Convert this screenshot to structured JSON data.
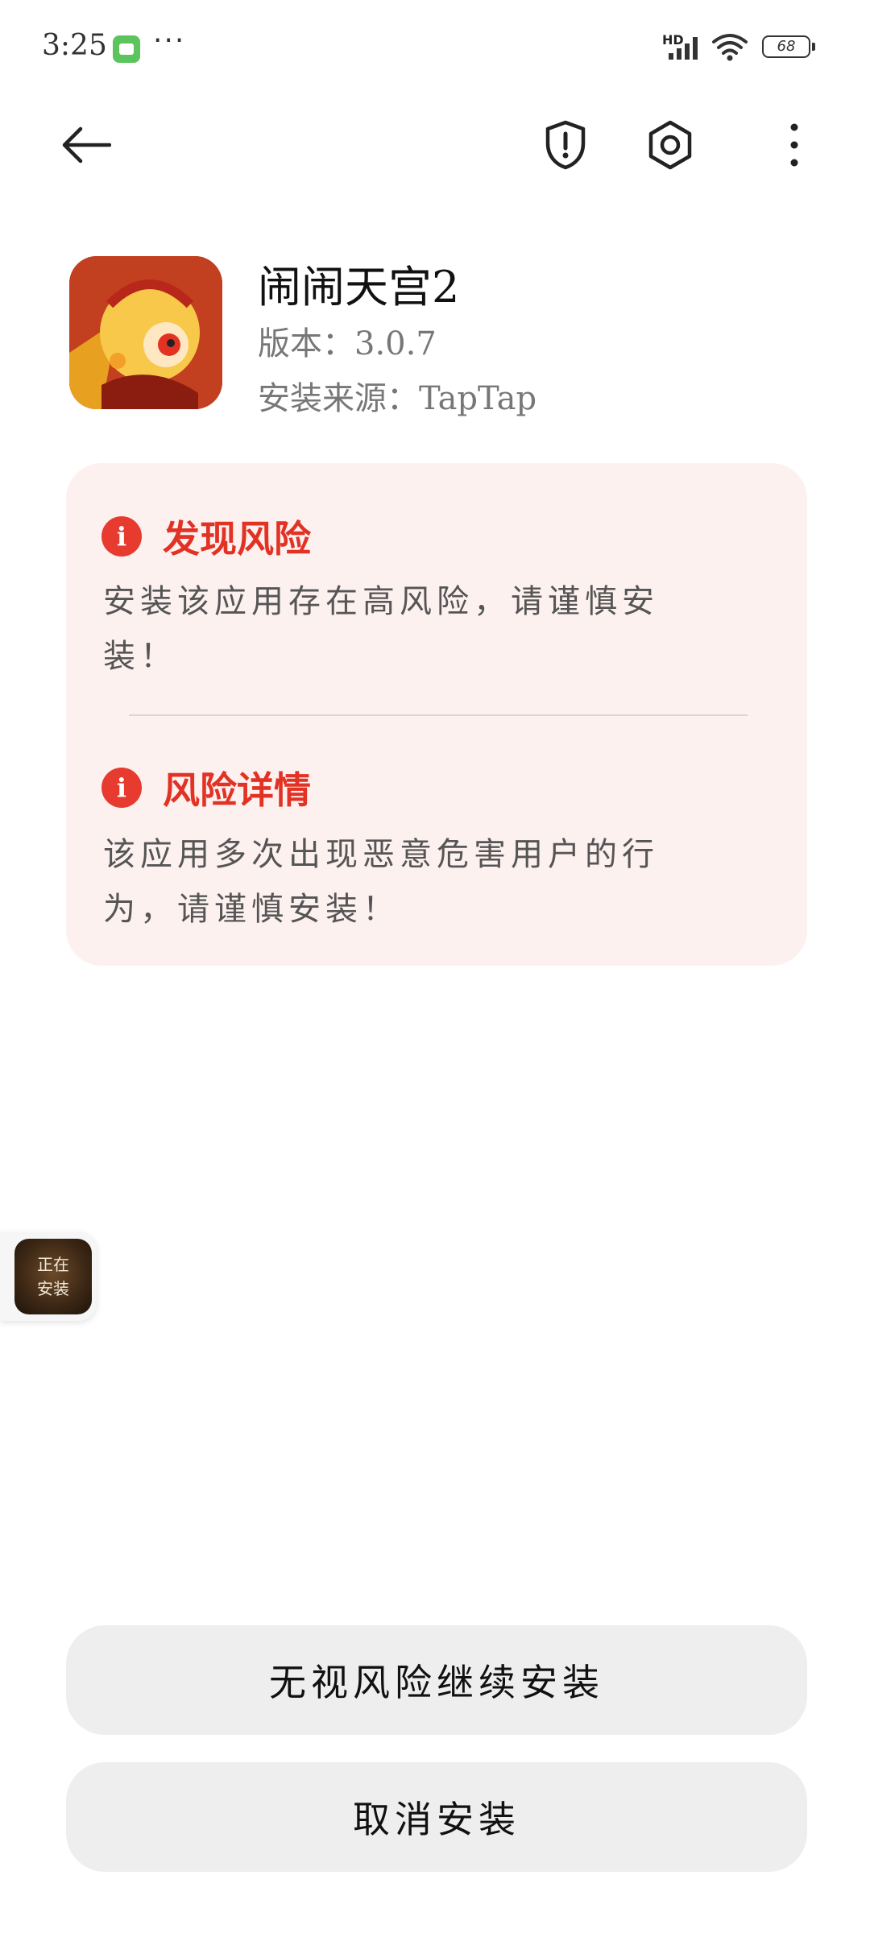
{
  "status_bar": {
    "time": "3:25",
    "more": "···",
    "network": "HD",
    "battery": "68"
  },
  "app": {
    "name": "闹闹天宫2",
    "version_label": "版本：",
    "version": "3.0.7",
    "source_label": "安装来源：",
    "source": "TapTap"
  },
  "risk": {
    "found": {
      "title": "发现风险",
      "body": "安装该应用存在高风险，请谨慎安装！"
    },
    "detail": {
      "title": "风险详情",
      "body": "该应用多次出现恶意危害用户的行为，请谨慎安装！"
    },
    "alert_glyph": "i",
    "accent_color": "#e23224",
    "card_color": "#fdf1f0"
  },
  "floating_badge": {
    "line1": "正在",
    "line2": "安装"
  },
  "actions": {
    "continue_label": "无视风险继续安装",
    "cancel_label": "取消安装"
  }
}
